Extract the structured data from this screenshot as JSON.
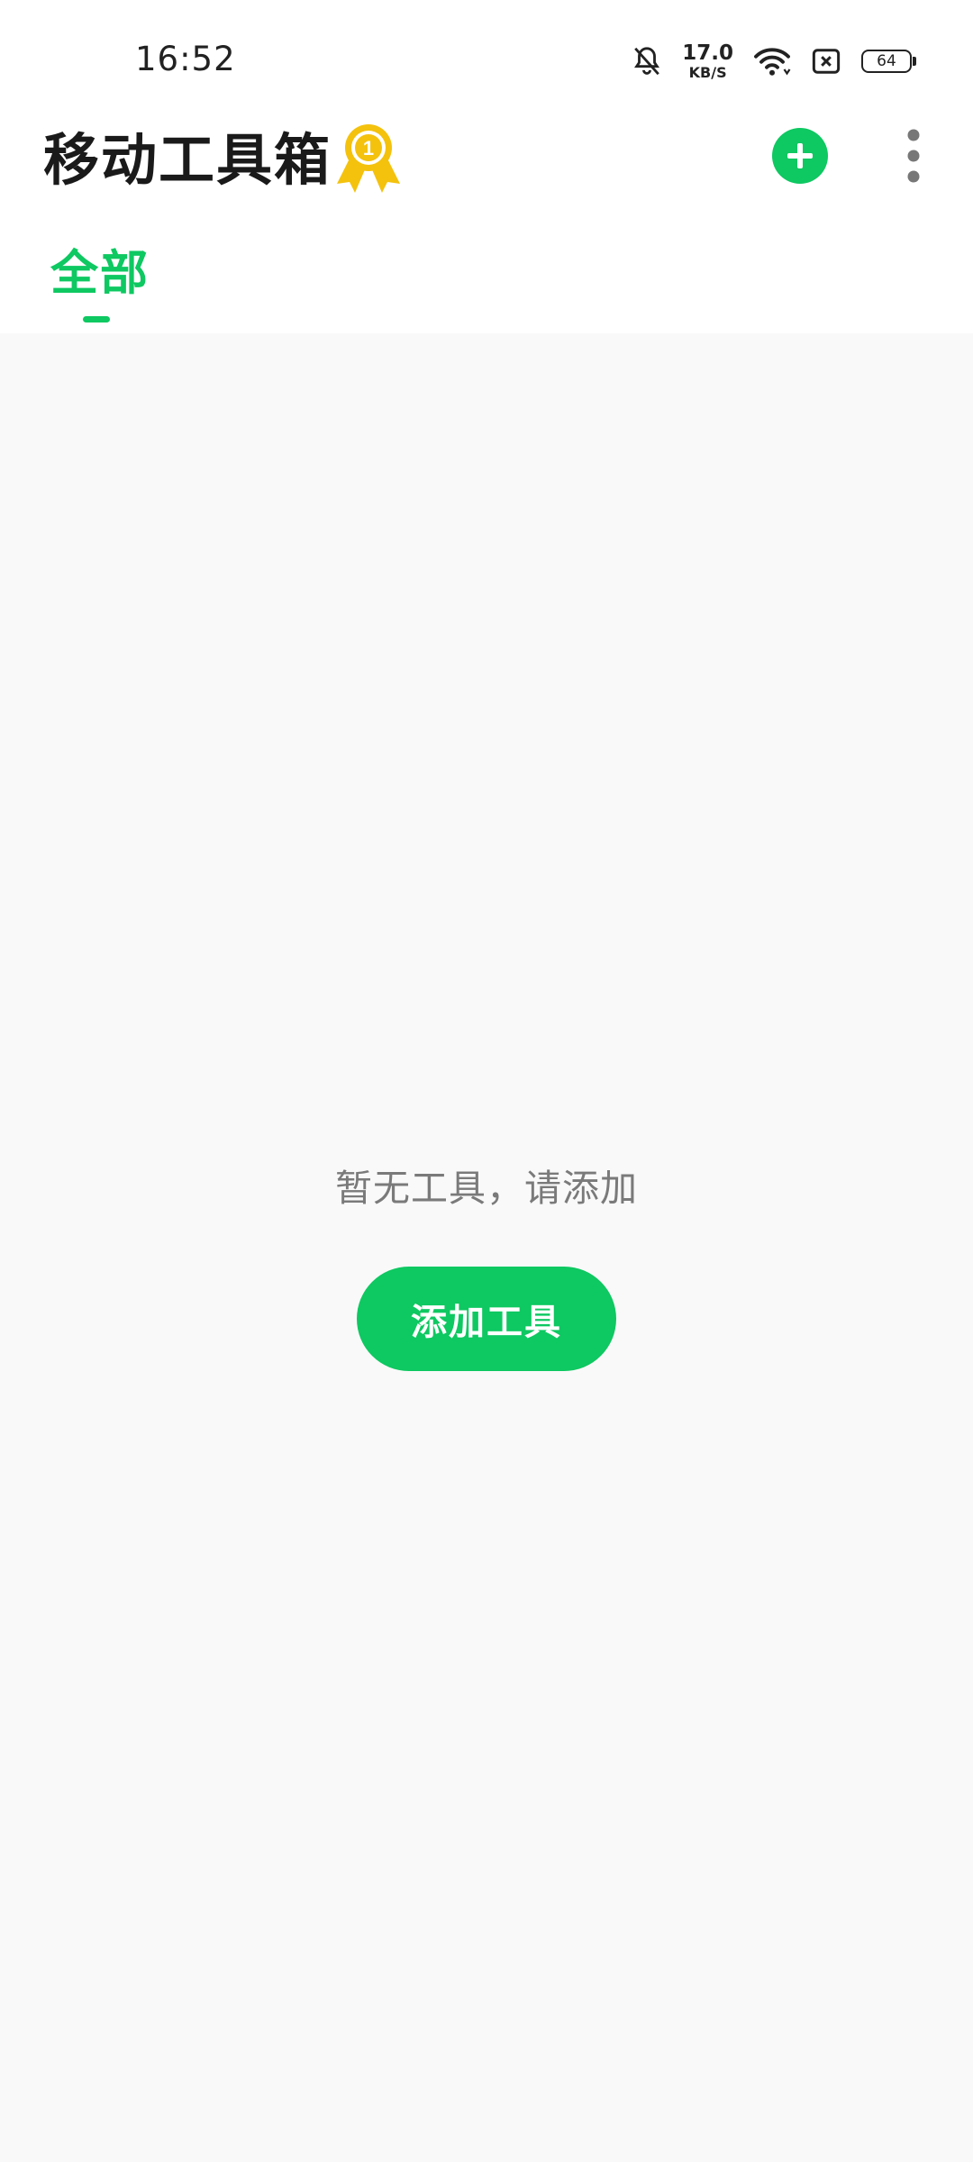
{
  "status_bar": {
    "time": "16:52",
    "net_speed_value": "17.0",
    "net_speed_unit": "KB/S",
    "battery_level": "64",
    "icons": [
      "bell-off-icon",
      "wifi-icon",
      "sim-error-icon",
      "battery-icon"
    ]
  },
  "header": {
    "title": "移动工具箱",
    "badge_icon": "medal-rank-1-icon",
    "badge_number": "1",
    "add_icon": "plus-circle-icon",
    "more_icon": "more-vertical-icon"
  },
  "tabs": [
    {
      "label": "全部",
      "active": true
    }
  ],
  "empty_state": {
    "message": "暂无工具，请添加",
    "button_label": "添加工具"
  },
  "colors": {
    "accent": "#0ec861",
    "medal": "#f4c20d",
    "background": "#f9f9f9",
    "header_background": "#ffffff"
  }
}
